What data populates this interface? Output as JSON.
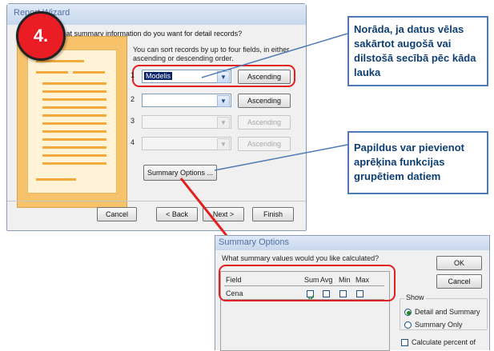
{
  "wizard": {
    "title": "Report Wizard",
    "question": "What summary information do you want for detail records?",
    "instruction": "You can sort records by up to four fields, in either ascending or descending order.",
    "sort_rows": [
      {
        "num": "1",
        "value": "Modelis",
        "order": "Ascending",
        "enabled": true
      },
      {
        "num": "2",
        "value": "",
        "order": "Ascending",
        "enabled": true
      },
      {
        "num": "3",
        "value": "",
        "order": "Ascending",
        "enabled": false
      },
      {
        "num": "4",
        "value": "",
        "order": "Ascending",
        "enabled": false
      }
    ],
    "summary_button": "Summary Options ...",
    "buttons": {
      "cancel": "Cancel",
      "back": "< Back",
      "next": "Next >",
      "finish": "Finish"
    }
  },
  "badge": "4.",
  "callouts": {
    "sort": "Norāda, ja datus vēlas sakārtot augošā vai dilstošā secībā pēc kāda lauka",
    "summary": "Papildus var pievienot aprēķina funkcijas grupētiem datiem"
  },
  "summary_dialog": {
    "title": "Summary Options",
    "question": "What summary values would you like calculated?",
    "field_header": "Field",
    "columns": [
      "Sum",
      "Avg",
      "Min",
      "Max"
    ],
    "rows": [
      {
        "field": "Cena",
        "checked": [
          true,
          false,
          false,
          false
        ]
      }
    ],
    "ok": "OK",
    "cancel": "Cancel",
    "show_label": "Show",
    "detail_and_summary": "Detail and Summary",
    "summary_only": "Summary Only",
    "calc_percent": "Calculate percent of"
  },
  "colors": {
    "highlight": "#e21f1f",
    "callout_text": "#0f3f72",
    "callout_border": "#4f7ab3"
  }
}
